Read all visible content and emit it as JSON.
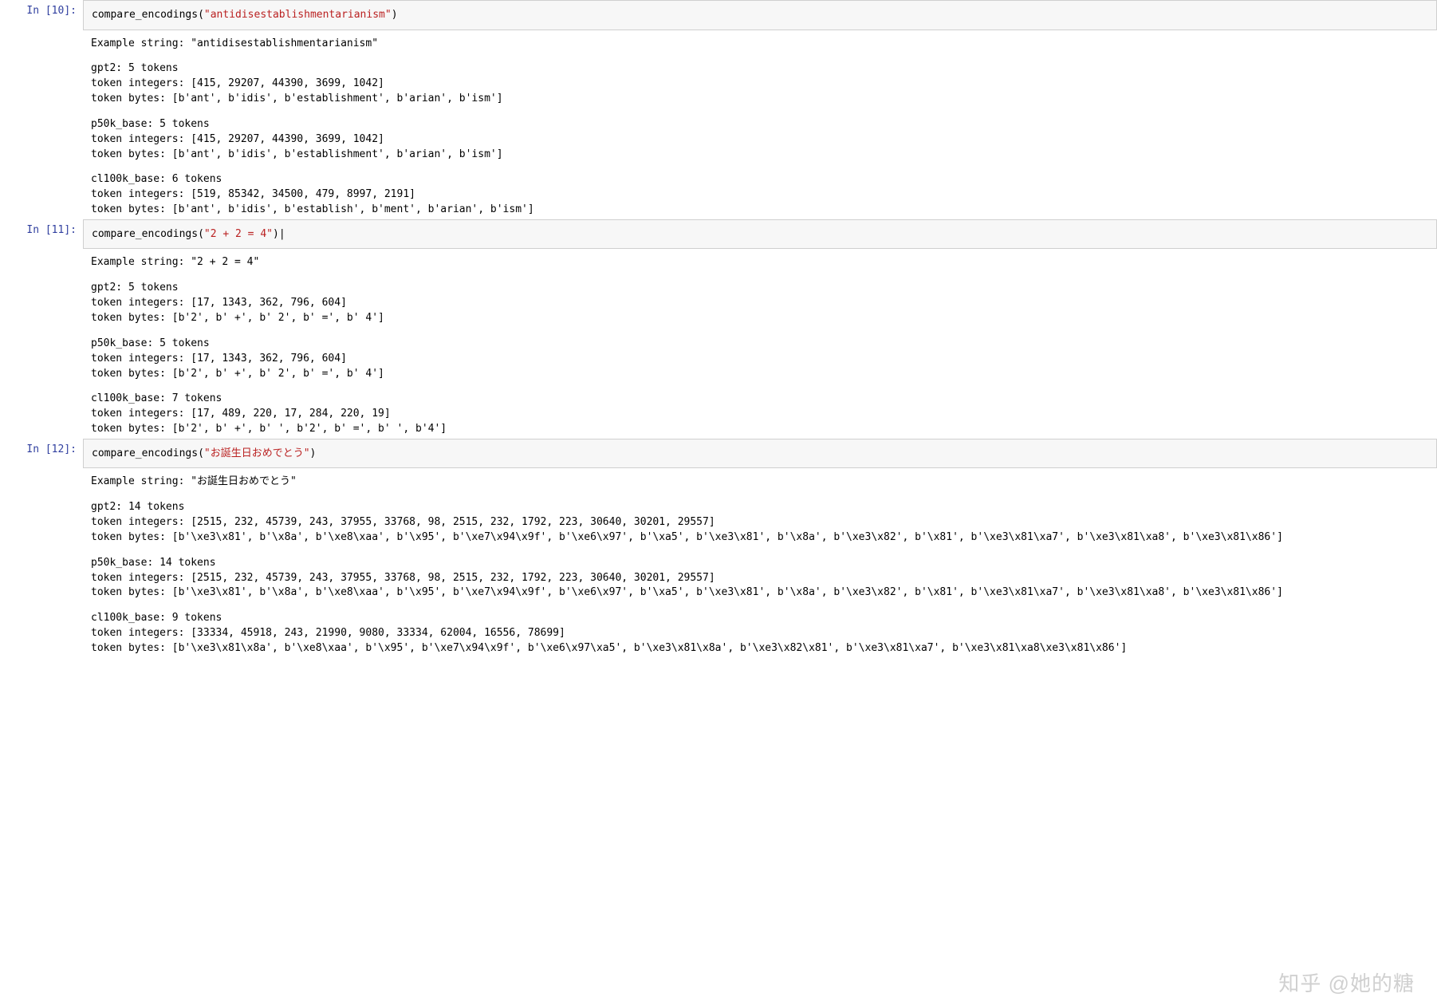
{
  "cells": [
    {
      "prompt": "In [10]:",
      "code": {
        "fn": "compare_encodings",
        "arg": "\"antidisestablishmentarianism\"",
        "suffix": ""
      },
      "output": [
        "Example string: \"antidisestablishmentarianism\"",
        "",
        "gpt2: 5 tokens",
        "token integers: [415, 29207, 44390, 3699, 1042]",
        "token bytes: [b'ant', b'idis', b'establishment', b'arian', b'ism']",
        "",
        "p50k_base: 5 tokens",
        "token integers: [415, 29207, 44390, 3699, 1042]",
        "token bytes: [b'ant', b'idis', b'establishment', b'arian', b'ism']",
        "",
        "cl100k_base: 6 tokens",
        "token integers: [519, 85342, 34500, 479, 8997, 2191]",
        "token bytes: [b'ant', b'idis', b'establish', b'ment', b'arian', b'ism']"
      ]
    },
    {
      "prompt": "In [11]:",
      "code": {
        "fn": "compare_encodings",
        "arg": "\"2 + 2 = 4\"",
        "suffix": "|"
      },
      "output": [
        "Example string: \"2 + 2 = 4\"",
        "",
        "gpt2: 5 tokens",
        "token integers: [17, 1343, 362, 796, 604]",
        "token bytes: [b'2', b' +', b' 2', b' =', b' 4']",
        "",
        "p50k_base: 5 tokens",
        "token integers: [17, 1343, 362, 796, 604]",
        "token bytes: [b'2', b' +', b' 2', b' =', b' 4']",
        "",
        "cl100k_base: 7 tokens",
        "token integers: [17, 489, 220, 17, 284, 220, 19]",
        "token bytes: [b'2', b' +', b' ', b'2', b' =', b' ', b'4']"
      ]
    },
    {
      "prompt": "In [12]:",
      "code": {
        "fn": "compare_encodings",
        "arg": "\"お誕生日おめでとう\"",
        "suffix": ""
      },
      "output": [
        "Example string: \"お誕生日おめでとう\"",
        "",
        "gpt2: 14 tokens",
        "token integers: [2515, 232, 45739, 243, 37955, 33768, 98, 2515, 232, 1792, 223, 30640, 30201, 29557]",
        "token bytes: [b'\\xe3\\x81', b'\\x8a', b'\\xe8\\xaa', b'\\x95', b'\\xe7\\x94\\x9f', b'\\xe6\\x97', b'\\xa5', b'\\xe3\\x81', b'\\x8a', b'\\xe3\\x82', b'\\x81', b'\\xe3\\x81\\xa7', b'\\xe3\\x81\\xa8', b'\\xe3\\x81\\x86']",
        "",
        "p50k_base: 14 tokens",
        "token integers: [2515, 232, 45739, 243, 37955, 33768, 98, 2515, 232, 1792, 223, 30640, 30201, 29557]",
        "token bytes: [b'\\xe3\\x81', b'\\x8a', b'\\xe8\\xaa', b'\\x95', b'\\xe7\\x94\\x9f', b'\\xe6\\x97', b'\\xa5', b'\\xe3\\x81', b'\\x8a', b'\\xe3\\x82', b'\\x81', b'\\xe3\\x81\\xa7', b'\\xe3\\x81\\xa8', b'\\xe3\\x81\\x86']",
        "",
        "cl100k_base: 9 tokens",
        "token integers: [33334, 45918, 243, 21990, 9080, 33334, 62004, 16556, 78699]",
        "token bytes: [b'\\xe3\\x81\\x8a', b'\\xe8\\xaa', b'\\x95', b'\\xe7\\x94\\x9f', b'\\xe6\\x97\\xa5', b'\\xe3\\x81\\x8a', b'\\xe3\\x82\\x81', b'\\xe3\\x81\\xa7', b'\\xe3\\x81\\xa8\\xe3\\x81\\x86']"
      ]
    }
  ],
  "watermark": "知乎 @她的糖"
}
